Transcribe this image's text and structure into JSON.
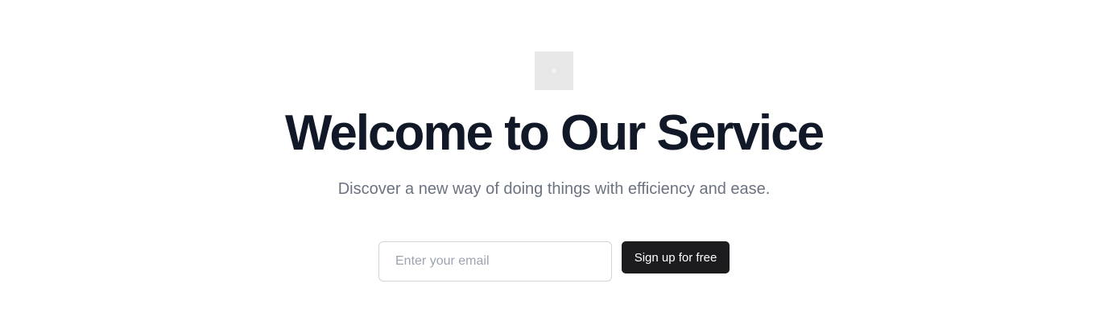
{
  "hero": {
    "logo_icon": "placeholder-image-icon",
    "title": "Welcome to Our Service",
    "subtitle": "Discover a new way of doing things with efficiency and ease."
  },
  "signup": {
    "email_placeholder": "Enter your email",
    "email_value": "",
    "button_label": "Sign up for free"
  },
  "colors": {
    "title": "#111827",
    "subtitle": "#6b7280",
    "button_bg": "#1c1c1e",
    "button_text": "#ffffff",
    "input_border": "#d1d5db",
    "logo_bg": "#e8e8e8"
  }
}
